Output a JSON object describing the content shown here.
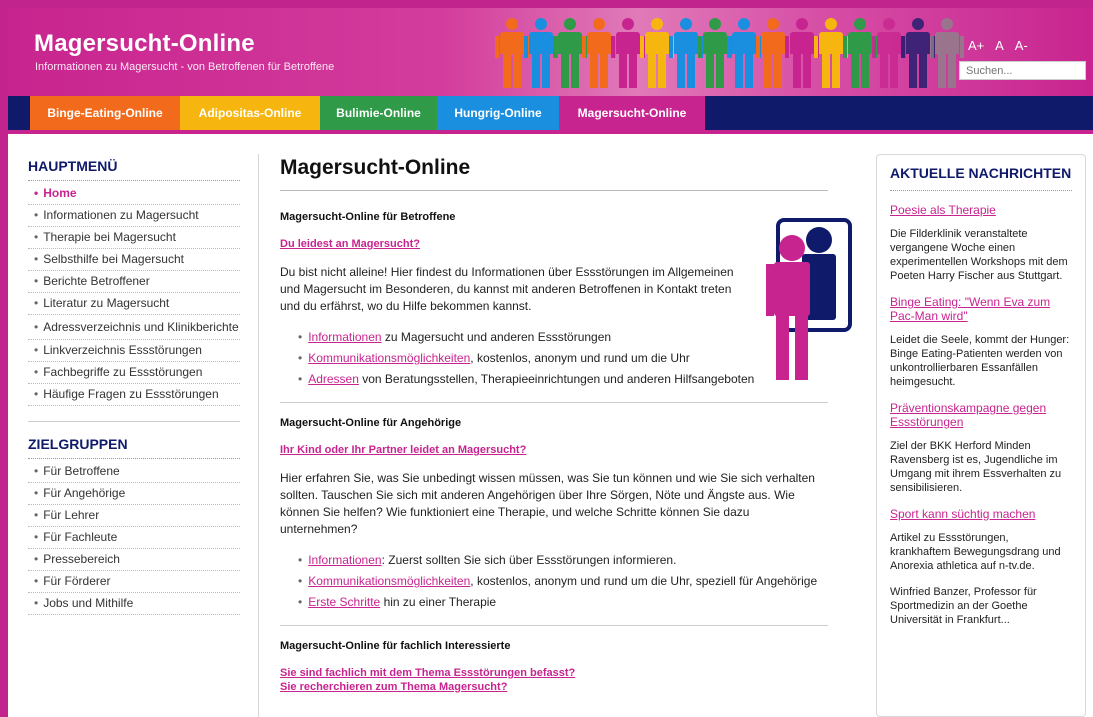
{
  "header": {
    "title": "Magersucht-Online",
    "subtitle": "Informationen zu Magersucht - von Betroffenen für Betroffene",
    "font_controls": [
      "A+",
      "A",
      "A-"
    ],
    "search_placeholder": "Suchen..."
  },
  "nav": {
    "tabs": [
      {
        "label": "Binge-Eating-Online",
        "color": "#f26b1d"
      },
      {
        "label": "Adipositas-Online",
        "color": "#f7b60f"
      },
      {
        "label": "Bulimie-Online",
        "color": "#2f9a48"
      },
      {
        "label": "Hungrig-Online",
        "color": "#1a8fe0"
      },
      {
        "label": "Magersucht-Online",
        "color": "#c8248f"
      }
    ],
    "background": "#0f1a6a"
  },
  "sidebar": {
    "hauptmenu_heading": "HAUPTMENÜ",
    "hauptmenu_items": [
      {
        "label": "Home"
      },
      {
        "label": "Informationen zu Magersucht"
      },
      {
        "label": "Therapie bei Magersucht"
      },
      {
        "label": "Selbsthilfe bei Magersucht"
      },
      {
        "label": "Berichte Betroffener"
      },
      {
        "label": "Literatur zu Magersucht"
      },
      {
        "label": "Adressverzeichnis und Klinikberichte"
      },
      {
        "label": "Linkverzeichnis Essstörungen"
      },
      {
        "label": "Fachbegriffe zu Essstörungen"
      },
      {
        "label": "Häufige Fragen zu Essstörungen"
      }
    ],
    "zielgruppen_heading": "ZIELGRUPPEN",
    "zielgruppen_items": [
      {
        "label": "Für Betroffene"
      },
      {
        "label": "Für Angehörige"
      },
      {
        "label": "Für Lehrer"
      },
      {
        "label": "Für Fachleute"
      },
      {
        "label": "Pressebereich"
      },
      {
        "label": "Für Förderer"
      },
      {
        "label": "Jobs und Mithilfe"
      }
    ]
  },
  "main": {
    "title": "Magersucht-Online",
    "betroffene": {
      "heading": "Magersucht-Online für Betroffene",
      "link": "Du leidest an Magersucht?",
      "para": "Du bist nicht alleine! Hier findest du Informationen über Essstörungen im Allgemeinen und Magersucht im Besonderen, du kannst mit anderen Betroffenen in Kontakt treten und du erfährst, wo du Hilfe bekommen kannst.",
      "bullets": [
        {
          "link": "Informationen",
          "text": " zu Magersucht und anderen Essstörungen"
        },
        {
          "link": "Kommunikationsmöglichkeiten",
          "text": ", kostenlos, anonym und rund um die Uhr"
        },
        {
          "link": "Adressen",
          "text": " von Beratungsstellen, Therapieeinrichtungen und anderen Hilfsangeboten"
        }
      ]
    },
    "angehoerige": {
      "heading": "Magersucht-Online für Angehörige",
      "link": "Ihr Kind oder Ihr Partner leidet an Magersucht?",
      "para": "Hier erfahren Sie, was Sie unbedingt wissen müssen, was Sie tun können und wie Sie sich verhalten sollten. Tauschen Sie sich mit anderen Angehörigen über Ihre Sörgen, Nöte und Ängste aus. Wie können Sie helfen? Wie funktioniert eine Therapie, und welche Schritte können Sie dazu unternehmen?",
      "bullets": [
        {
          "link": "Informationen",
          "text": ": Zuerst sollten Sie sich über Essstörungen informieren."
        },
        {
          "link": "Kommunikationsmöglichkeiten",
          "text": ", kostenlos, anonym und rund um die Uhr, speziell für Angehörige"
        },
        {
          "link": "Erste Schritte",
          "text": " hin zu einer Therapie"
        }
      ]
    },
    "fachlich": {
      "heading": "Magersucht-Online für fachlich Interessierte",
      "link1": "Sie sind fachlich mit dem Thema Essstörungen befasst?",
      "link2": "Sie recherchieren zum Thema Magersucht?"
    }
  },
  "news": {
    "heading": "AKTUELLE NACHRICHTEN",
    "items": [
      {
        "title": "Poesie als Therapie",
        "text": "Die Filderklinik veranstaltete vergangene Woche einen experimentellen Workshops mit dem Poeten Harry Fischer aus Stuttgart."
      },
      {
        "title": "Binge Eating: \"Wenn Eva zum Pac-Man wird\"",
        "text": "Leidet die Seele, kommt der Hunger: Binge Eating-Patienten werden von unkontrollierbaren Essanfällen heimgesucht."
      },
      {
        "title": "Präventionskampagne gegen Essstörungen",
        "text": "Ziel der BKK Herford Minden Ravensberg ist es, Jugendliche im Umgang mit ihrem Essverhalten zu sensibilisieren."
      },
      {
        "title": "Sport kann süchtig machen",
        "text": "Artikel zu Essstörungen, krankhaftem Bewegungsdrang und Anorexia athletica auf n-tv.de."
      }
    ],
    "extra_text": "Winfried Banzer, Professor für Sportmedizin an der Goethe Universität in Frankfurt..."
  },
  "colors": {
    "accent_pink": "#c8248f",
    "navy": "#0f1a6a",
    "figure_palette": [
      "#f26b1d",
      "#1a8fe0",
      "#2f9a48",
      "#f7b60f",
      "#c8248f",
      "#0f1a6a",
      "#888888"
    ]
  },
  "icons": {
    "header_figures": "people-figures-banner",
    "betroffene_illustration": "two-persons-icon"
  }
}
